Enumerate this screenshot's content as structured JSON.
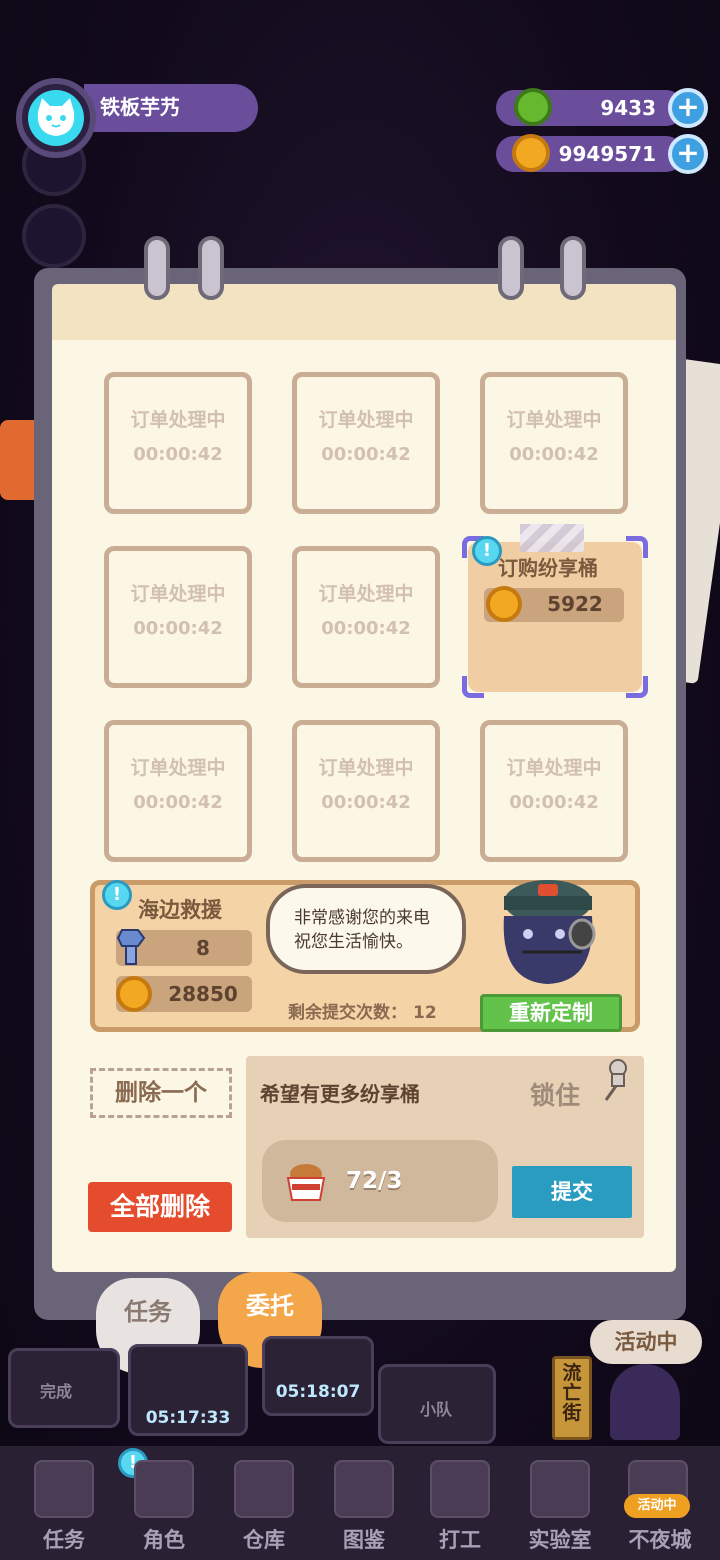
{
  "player": {
    "name": "铁板芋艿"
  },
  "resources": [
    {
      "icon": "donut-icon",
      "value": "9433",
      "color": "#66b82e"
    },
    {
      "icon": "planet-coin-icon",
      "value": "9949571",
      "color": "#f2a821"
    }
  ],
  "orders": {
    "slots": [
      {
        "status": "订单处理中",
        "timer": "00:00:42"
      },
      {
        "status": "订单处理中",
        "timer": "00:00:42"
      },
      {
        "status": "订单处理中",
        "timer": "00:00:42"
      },
      {
        "status": "订单处理中",
        "timer": "00:00:42"
      },
      {
        "status": "订单处理中",
        "timer": "00:00:42"
      },
      {
        "status": "订单处理中",
        "timer": "00:00:42"
      },
      {
        "status": "订单处理中",
        "timer": "00:00:42"
      },
      {
        "status": "订单处理中",
        "timer": "00:00:42"
      }
    ],
    "active": {
      "title": "订购纷享桶",
      "price": "5922",
      "badge": "!"
    }
  },
  "rescue": {
    "title": "海边救援",
    "badge": "!",
    "bolts": "8",
    "coins": "28850",
    "dialog": [
      "非常感谢您的来电",
      "祝您生活愉快。"
    ],
    "remaining_label": "剩余提交次数：",
    "remaining_value": "12",
    "redo_label": "重新定制"
  },
  "request": {
    "delete_one": "删除一个",
    "delete_all": "全部删除",
    "title": "希望有更多纷享桶",
    "lock_label": "锁住",
    "item_count": "72/3",
    "submit_label": "提交"
  },
  "tabs": {
    "task": "任务",
    "commission": "委托"
  },
  "scene": {
    "done_label": "完成",
    "timer1": "05:17:33",
    "timer2": "05:18:07",
    "team_label": "小队",
    "street_label": "流亡街",
    "event_label": "活动中"
  },
  "nav": [
    {
      "label": "任务",
      "icon": "clipboard-icon"
    },
    {
      "label": "角色",
      "icon": "character-icon"
    },
    {
      "label": "仓库",
      "icon": "warehouse-icon"
    },
    {
      "label": "图鉴",
      "icon": "book-icon"
    },
    {
      "label": "打工",
      "icon": "work-icon"
    },
    {
      "label": "实验室",
      "icon": "lab-icon"
    },
    {
      "label": "不夜城",
      "icon": "city-icon",
      "badge": "活动中"
    }
  ],
  "colors": {
    "accent_purple": "#6a4d9b",
    "confirm_green": "#62c24a",
    "danger_red": "#e54c2e",
    "submit_blue": "#2a9cc0"
  }
}
